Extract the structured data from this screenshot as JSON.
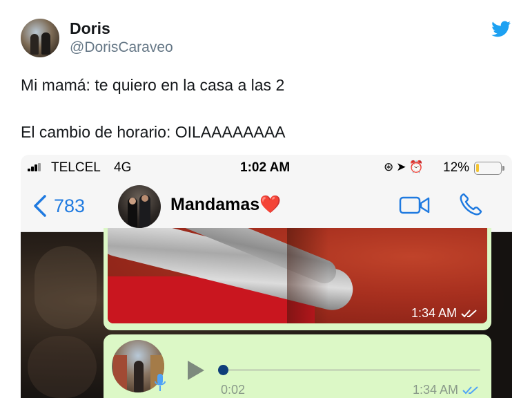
{
  "tweet": {
    "display_name": "Doris",
    "handle": "@DorisCaraveo",
    "lines": [
      "Mi mamá: te quiero en la casa a las 2",
      "El cambio de horario: OILAAAAAAAA"
    ]
  },
  "phone": {
    "status_bar": {
      "carrier": "TELCEL",
      "network": "4G",
      "time": "1:02 AM",
      "battery_percent": "12%",
      "battery_level": 0.12
    },
    "chat_header": {
      "back_count": "783",
      "contact_name": "Mandamas❤️"
    },
    "messages": {
      "image_message": {
        "time": "1:34 AM",
        "status_color": "#ffffff"
      },
      "audio_message": {
        "duration": "0:02",
        "time": "1:34 AM",
        "progress": 0.0,
        "status_color": "#4fa3f7"
      }
    }
  },
  "colors": {
    "twitter_blue": "#1da1f2",
    "ios_blue": "#1f7ae0",
    "bubble_green": "#dcf8c6"
  }
}
